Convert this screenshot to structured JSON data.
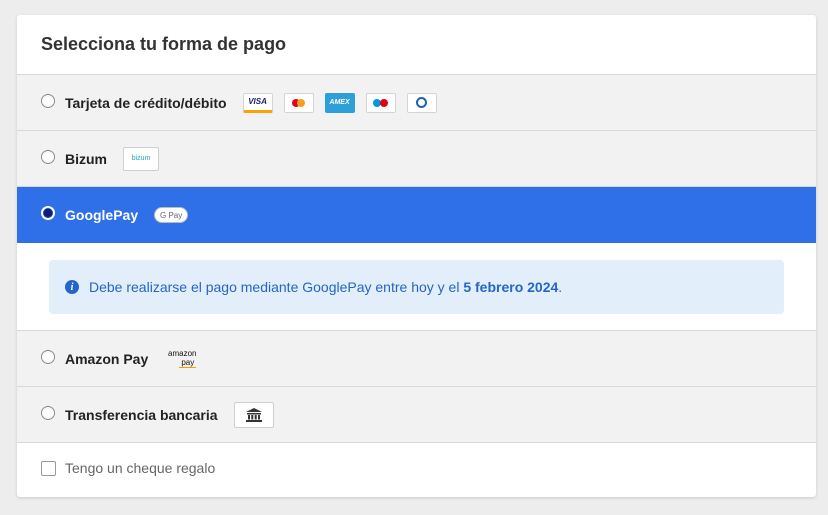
{
  "title": "Selecciona tu forma de pago",
  "options": [
    {
      "label": "Tarjeta de crédito/débito",
      "selected": false,
      "logos": [
        "visa",
        "mastercard",
        "amex",
        "maestro",
        "diners"
      ]
    },
    {
      "label": "Bizum",
      "selected": false,
      "logo_text": "bizum"
    },
    {
      "label": "GooglePay",
      "selected": true,
      "logo_text": "G Pay"
    },
    {
      "label": "Amazon Pay",
      "selected": false,
      "logo_text_top": "amazon",
      "logo_text_bottom": "pay"
    },
    {
      "label": "Transferencia bancaria",
      "selected": false,
      "logo_icon": "bank-icon"
    }
  ],
  "info": {
    "text_before": "Debe realizarse el pago mediante GooglePay entre hoy y el ",
    "date": "5 febrero 2024",
    "text_after": ".",
    "icon": "info-icon"
  },
  "gift": {
    "label": "Tengo un cheque regalo",
    "checked": false
  },
  "card_logos": {
    "visa": "VISA",
    "amex": "AMEX"
  },
  "colors": {
    "selected_bg": "#2f6fe8",
    "info_bg": "#e3eefb",
    "info_text": "#2565c7"
  }
}
